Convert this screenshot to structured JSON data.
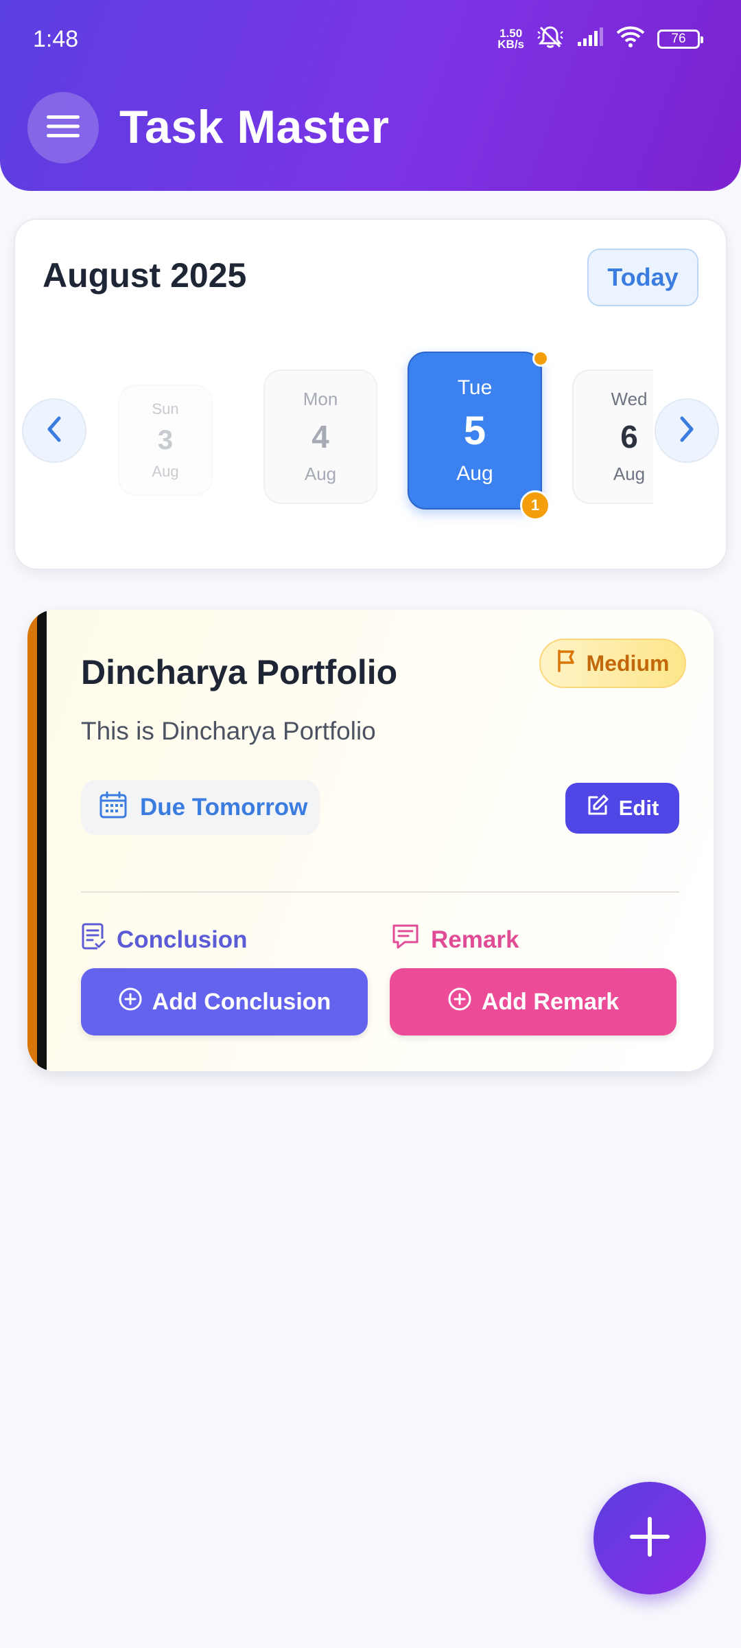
{
  "status_bar": {
    "time": "1:48",
    "net_speed_value": "1.50",
    "net_speed_unit": "KB/s",
    "battery": "76",
    "icons": [
      "mute-icon",
      "signal-icon",
      "wifi-icon",
      "battery-icon"
    ]
  },
  "header": {
    "title": "Task Master",
    "menu_icon": "hamburger-menu-icon"
  },
  "calendar": {
    "month_label": "August 2025",
    "today_label": "Today",
    "days": [
      {
        "day": "Sun",
        "date": "3",
        "month": "Aug"
      },
      {
        "day": "Mon",
        "date": "4",
        "month": "Aug"
      },
      {
        "day": "Tue",
        "date": "5",
        "month": "Aug",
        "selected": true,
        "task_count": "1"
      },
      {
        "day": "Wed",
        "date": "6",
        "month": "Aug"
      }
    ]
  },
  "task": {
    "title": "Dincharya Portfolio",
    "description": "This is Dincharya Portfolio",
    "priority": "Medium",
    "due": "Due Tomorrow",
    "edit_label": "Edit",
    "conclusion_label": "Conclusion",
    "remark_label": "Remark",
    "add_conclusion_label": "Add Conclusion",
    "add_remark_label": "Add Remark"
  },
  "colors": {
    "header_gradient_start": "#5b3fe0",
    "header_gradient_end": "#7d22cf",
    "selected_day": "#3b82f0",
    "badge": "#f59e0b",
    "priority_text": "#c2680a",
    "edit_button": "#4f46e5",
    "add_conclusion": "#6363ee",
    "add_remark": "#ec4b97",
    "task_accent": "#d97706"
  }
}
